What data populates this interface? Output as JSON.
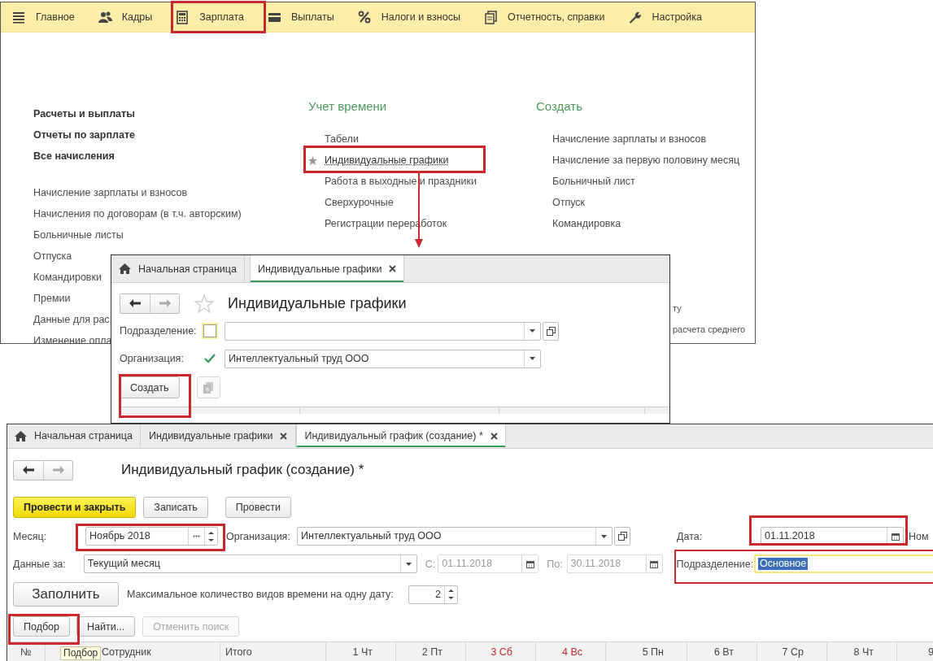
{
  "sections_window": {
    "menu": [
      {
        "label": "Главное"
      },
      {
        "label": "Кадры"
      },
      {
        "label": "Зарплата"
      },
      {
        "label": "Выплаты"
      },
      {
        "label": "Налоги и взносы"
      },
      {
        "label": "Отчетность, справки"
      },
      {
        "label": "Настройка"
      }
    ],
    "main_links": [
      "Расчеты и выплаты",
      "Отчеты по зарплате",
      "Все начисления"
    ],
    "links": [
      "Начисление зарплаты и взносов",
      "Начисления по договорам (в т.ч. авторским)",
      "Больничные листы",
      "Отпуска",
      "Командировки",
      "Премии",
      "Данные для рас",
      "Изменение опла"
    ],
    "time_tracking": {
      "title": "Учет времени",
      "items": [
        {
          "label": "Табели",
          "favorite": false
        },
        {
          "label": "Индивидуальные графики",
          "favorite": true
        },
        {
          "label": "Работа в выходные и праздники",
          "favorite": false
        },
        {
          "label": "Сверхурочные",
          "favorite": false
        },
        {
          "label": "Регистрации переработок",
          "favorite": false
        }
      ]
    },
    "create": {
      "title": "Создать",
      "items": [
        "Начисление зарплаты и взносов",
        "Начисление за первую половину месяц",
        "Больничный лист",
        "Отпуск",
        "Командировка"
      ],
      "more_items": [
        "ту",
        "расчета среднего"
      ]
    }
  },
  "list_window": {
    "tabs": [
      {
        "kind": "home",
        "label": "Начальная страница",
        "selected": false
      },
      {
        "kind": "document",
        "label": "Индивидуальные графики",
        "selected": true
      }
    ],
    "title": "Индивидуальные графики",
    "filters": [
      {
        "label": "Подразделение:",
        "checked": false
      },
      {
        "label": "Организация:",
        "checked": true,
        "value": "Интеллектуальный труд ООО"
      }
    ],
    "buttons": [
      {
        "kind": "text",
        "label": "Создать"
      },
      {
        "kind": "copy"
      }
    ]
  },
  "form_window": {
    "tabs": [
      {
        "kind": "home",
        "label": "Начальная страница",
        "selected": false
      },
      {
        "kind": "document",
        "label": "Индивидуальные графики",
        "selected": false
      },
      {
        "kind": "document",
        "label": "Индивидуальный график (создание) *",
        "selected": true
      }
    ],
    "title": "Индивидуальный график (создание) *",
    "commands": [
      {
        "label": "Провести и закрыть",
        "default": true
      },
      {
        "label": "Записать",
        "default": false
      },
      {
        "label": "Провести",
        "default": false
      }
    ],
    "month": {
      "label": "Месяц:",
      "value": "Ноябрь 2018"
    },
    "organization": {
      "label": "Организация:",
      "value": "Интеллектуальный труд ООО"
    },
    "date": {
      "label": "Дата:",
      "value": "01.11.2018"
    },
    "number_label": "Ном",
    "period": {
      "label": "Данные за:",
      "value": "Текущий месяц"
    },
    "from": {
      "label": "С:",
      "value": "01.11.2018",
      "disabled": true
    },
    "to": {
      "label": "По:",
      "value": "30.11.2018",
      "disabled": true
    },
    "department": {
      "label": "Подразделение:",
      "value": "Основное",
      "text_selected": true
    },
    "fill_button": "Заполнить",
    "max_types": {
      "label": "Максимальное количество видов времени на одну дату:",
      "value": "2"
    },
    "table_commands": [
      {
        "label": "Подбор",
        "disabled": false
      },
      {
        "label": "Найти...",
        "disabled": false
      },
      {
        "label": "Отменить поиск",
        "disabled": true
      }
    ],
    "tooltip": "Подбор",
    "columns": [
      {
        "label": "№",
        "weekend": false
      },
      {
        "label": "Сотрудник",
        "weekend": false
      },
      {
        "label": "Итого",
        "weekend": false
      },
      {
        "label": "1 Чт",
        "weekend": false
      },
      {
        "label": "2 Пт",
        "weekend": false
      },
      {
        "label": "3 Сб",
        "weekend": true
      },
      {
        "label": "4 Вс",
        "weekend": true
      },
      {
        "label": "5 Пн",
        "weekend": false
      },
      {
        "label": "6 Вт",
        "weekend": false
      },
      {
        "label": "7 Ср",
        "weekend": false
      },
      {
        "label": "8 Чт",
        "weekend": false
      },
      {
        "label": "9",
        "weekend": false
      }
    ]
  }
}
